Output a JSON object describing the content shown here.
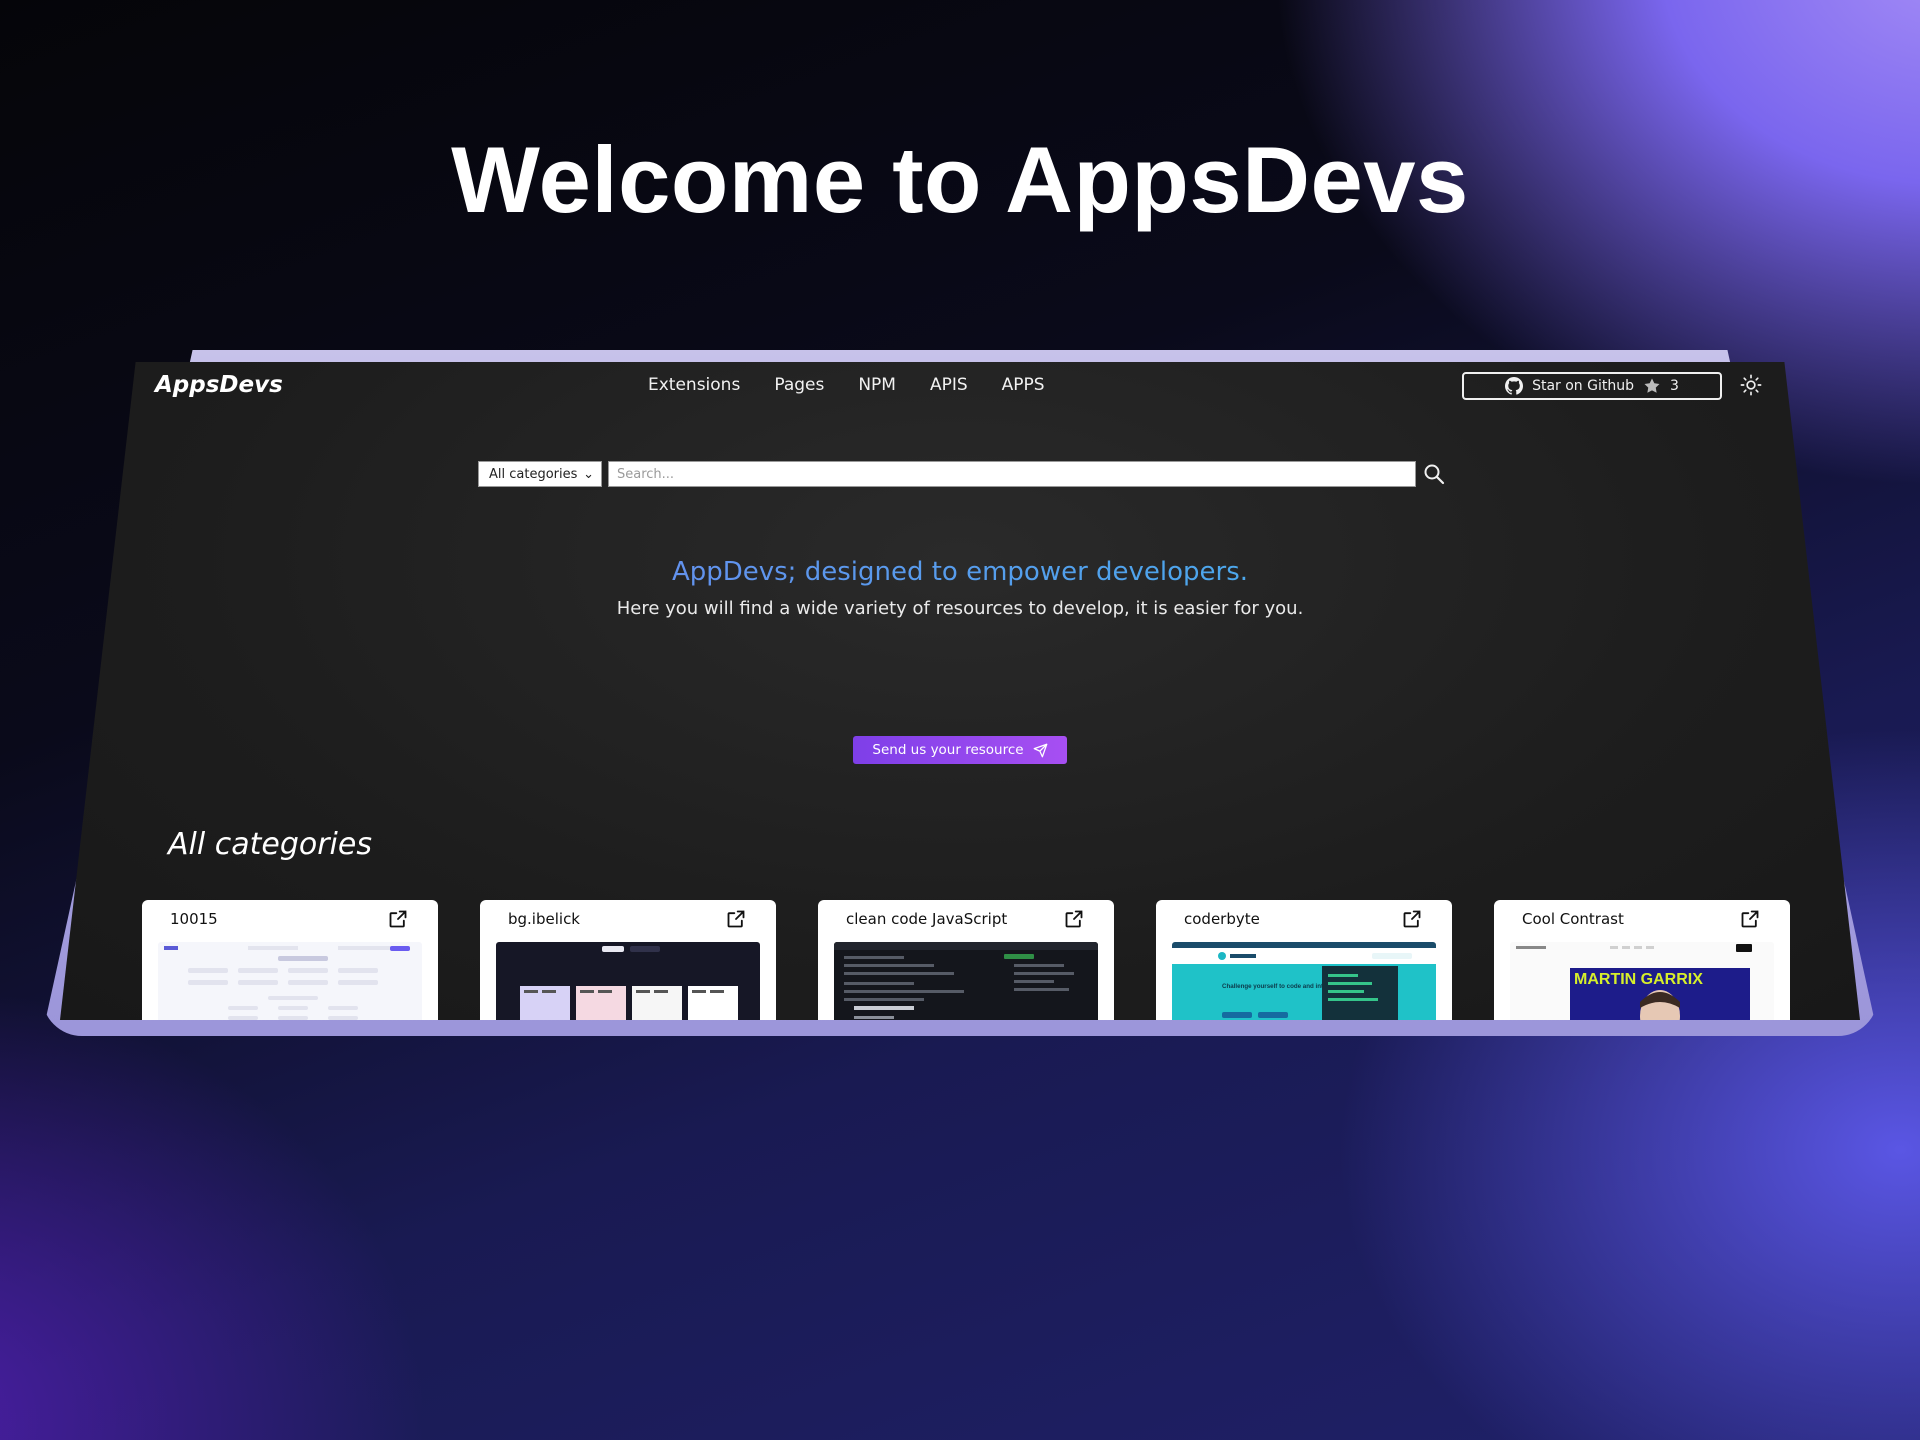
{
  "promo": {
    "headline": "Welcome to AppsDevs"
  },
  "site": {
    "logo": "AppsDevs",
    "nav": [
      "Extensions",
      "Pages",
      "NPM",
      "APIS",
      "APPS"
    ],
    "github": {
      "label": "Star on Github",
      "stars": "3"
    },
    "search": {
      "category": "All categories",
      "placeholder": "Search..."
    },
    "hero": {
      "tagline": "AppDevs; designed to empower developers.",
      "subtitle": "Here you will find a wide variety of resources to develop, it is easier for you."
    },
    "send_button": "Send us your resource",
    "section_title": "All categories",
    "cards": [
      {
        "title": "10015"
      },
      {
        "title": "bg.ibelick"
      },
      {
        "title": "clean code JavaScript"
      },
      {
        "title": "coderbyte",
        "preview_text": "Challenge yourself to code and interview better."
      },
      {
        "title": "Cool Contrast",
        "preview_text": "MARTIN GARRIX"
      }
    ]
  },
  "colors": {
    "accent_purple": "#8b45ee",
    "tagline_blue": "#4fa3ec",
    "device_frame": "#b1abe4"
  }
}
